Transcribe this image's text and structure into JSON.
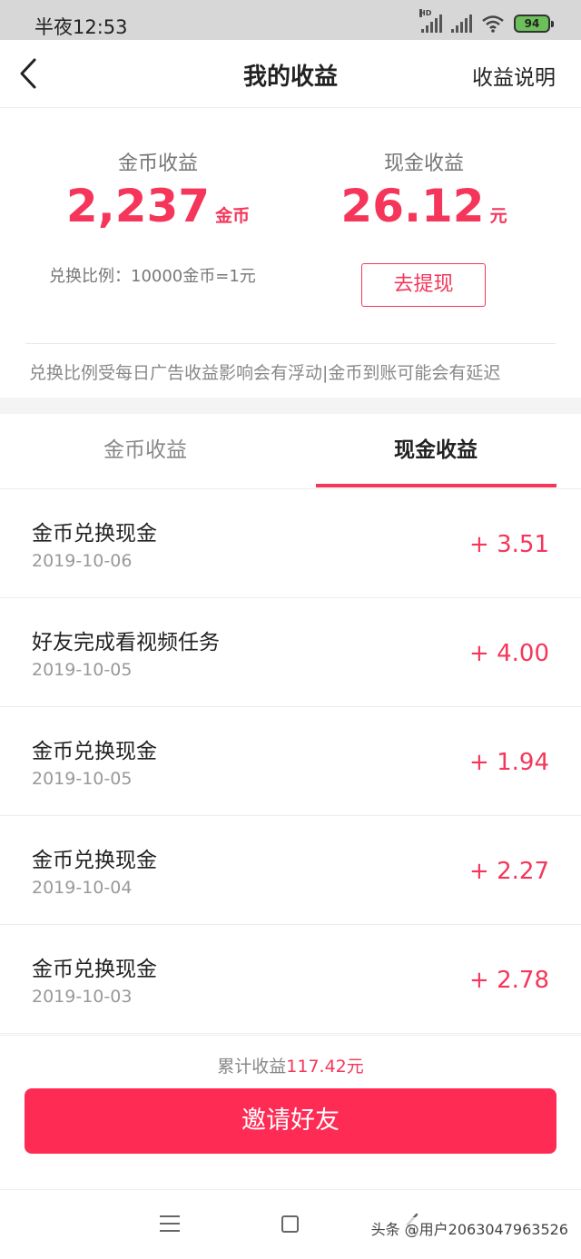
{
  "status_bar": {
    "time": "半夜12:53",
    "signal_label": "HD",
    "battery": "94"
  },
  "header": {
    "title": "我的收益",
    "help_label": "收益说明"
  },
  "summary": {
    "coin_label": "金币收益",
    "coin_value": "2,237",
    "coin_unit": "金币",
    "cash_label": "现金收益",
    "cash_value": "26.12",
    "cash_unit": "元",
    "ratio_text": "兑换比例：10000金币=1元",
    "withdraw_label": "去提现",
    "notice": "兑换比例受每日广告收益影响会有浮动|金币到账可能会有延迟"
  },
  "tabs": [
    {
      "label": "金币收益",
      "active": false
    },
    {
      "label": "现金收益",
      "active": true
    }
  ],
  "records": [
    {
      "title": "金币兑换现金",
      "date": "2019-10-06",
      "amount": "+ 3.51"
    },
    {
      "title": "好友完成看视频任务",
      "date": "2019-10-05",
      "amount": "+ 4.00"
    },
    {
      "title": "金币兑换现金",
      "date": "2019-10-05",
      "amount": "+ 1.94"
    },
    {
      "title": "金币兑换现金",
      "date": "2019-10-04",
      "amount": "+ 2.27"
    },
    {
      "title": "金币兑换现金",
      "date": "2019-10-03",
      "amount": "+ 2.78"
    }
  ],
  "footer": {
    "total_prefix": "累计收益",
    "total_value": "117.42元",
    "invite_label": "邀请好友"
  },
  "watermark": "头条 @用户2063047963526",
  "colors": {
    "accent": "#f5365a",
    "invite_button": "#fe2c55",
    "status_bar": "#d7d7d7"
  }
}
